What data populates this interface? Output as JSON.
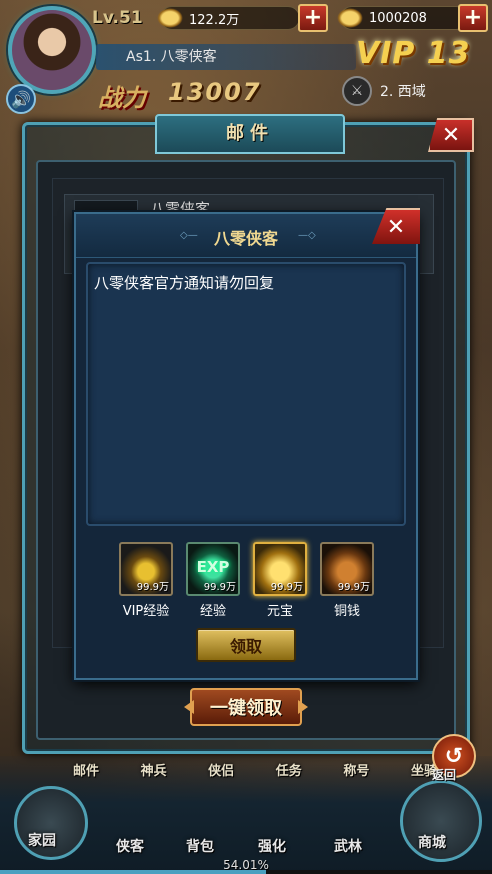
{
  "player": {
    "level": "Lv.51",
    "name": "As1. 八零侠客",
    "vip": "VIP 13",
    "power_label": "战力",
    "power": "13007",
    "server": "2. 西域"
  },
  "resources": {
    "gold": "122.2万",
    "yuanbao": "1000208",
    "plus": "+"
  },
  "mail": {
    "title": "邮件",
    "close": "✕",
    "list": [
      {
        "title": "八零侠客"
      }
    ]
  },
  "popup": {
    "title": "八零侠客",
    "close": "✕",
    "message": "八零侠客官方通知请勿回复",
    "rewards": [
      {
        "name": "VIP经验",
        "amount": "99.9万",
        "icon": "vip-exp-icon"
      },
      {
        "name": "经验",
        "amount": "99.9万",
        "icon": "exp-icon",
        "badge": "EXP"
      },
      {
        "name": "元宝",
        "amount": "99.9万",
        "icon": "yuanbao-icon"
      },
      {
        "name": "铜钱",
        "amount": "99.9万",
        "icon": "copper-coin-icon"
      }
    ],
    "claim_label": "领取",
    "claim_all_label": "一键领取"
  },
  "menu": [
    "邮件",
    "神兵",
    "侠侣",
    "任务",
    "称号",
    "坐骑"
  ],
  "nav": {
    "home": "家园",
    "hero": "侠客",
    "bag": "背包",
    "strengthen": "强化",
    "world": "武林",
    "shop": "商城",
    "back": "返回"
  },
  "progress": {
    "text": "54.01%",
    "value": 0.5401
  },
  "colors": {
    "frame_accent": "#4fa0b4",
    "close_red": "#c8302a",
    "gold_text": "#f0d890",
    "popup_bg": "#14263a"
  }
}
